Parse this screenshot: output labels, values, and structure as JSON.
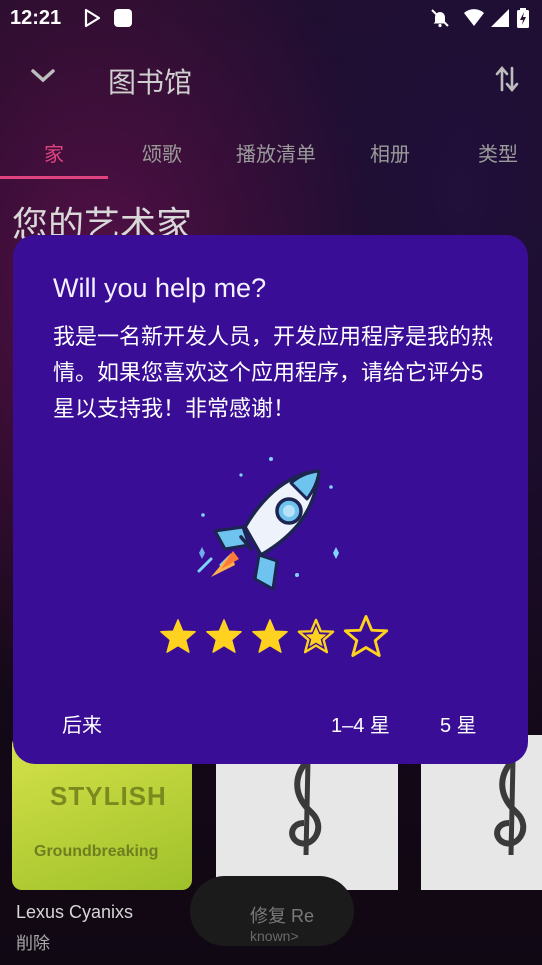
{
  "status": {
    "time": "12:21"
  },
  "app": {
    "title": "图书馆",
    "tabs": [
      "家",
      "颂歌",
      "播放清单",
      "相册",
      "类型"
    ],
    "active_tab_index": 0,
    "section_title": "您的艺术家"
  },
  "background_cards": {
    "card1_title": "STYLISH",
    "card1_sub": "Groundbreaking",
    "artist_name": "Lexus Cyanixs",
    "artist_sub": "削除",
    "mini_text": "修复 Re",
    "mini_text2": "known>"
  },
  "dialog": {
    "title": "Will you help me?",
    "message": "我是一名新开发人员，开发应用程序是我的热情。如果您喜欢这个应用程序，请给它评分5星以支持我！非常感谢！",
    "rating": 3.5,
    "max_rating": 5,
    "buttons": {
      "later": "后来",
      "one_to_four": "1–4 星",
      "five": "5 星"
    }
  },
  "colors": {
    "dialog_bg": "#3a0d96",
    "accent": "#e0447f",
    "star": "#ffd21f"
  }
}
